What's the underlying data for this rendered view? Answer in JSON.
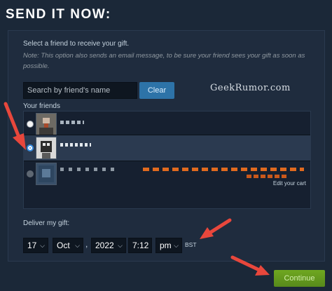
{
  "title": "SEND IT NOW:",
  "intro": "Select a friend to receive your gift.",
  "note": "Note: This option also sends an email message, to be sure your friend sees your gift as soon as possible.",
  "search": {
    "placeholder": "Search by friend's name",
    "clear_label": "Clear"
  },
  "watermark": "GeekRumor.com",
  "friends": {
    "label": "Your friends",
    "items": [
      {
        "state": "unselected",
        "avatar_color": "#6d6a64"
      },
      {
        "state": "selected",
        "avatar_color": "#d9d9d9"
      },
      {
        "state": "disabled",
        "avatar_color": "#39506a",
        "edit_label": "Edit your cart"
      }
    ]
  },
  "deliver": {
    "label": "Deliver my gift:",
    "day": "17",
    "month": "Oct",
    "separator": ",",
    "year": "2022",
    "time": "7:12",
    "ampm": "pm",
    "timezone": "BST"
  },
  "continue_label": "Continue",
  "colors": {
    "background": "#1b2838",
    "accent_blue": "#2d73a8",
    "continue_green": "#6fa720",
    "arrow_red": "#e8473c",
    "obscured_orange": "#e06a1f"
  }
}
